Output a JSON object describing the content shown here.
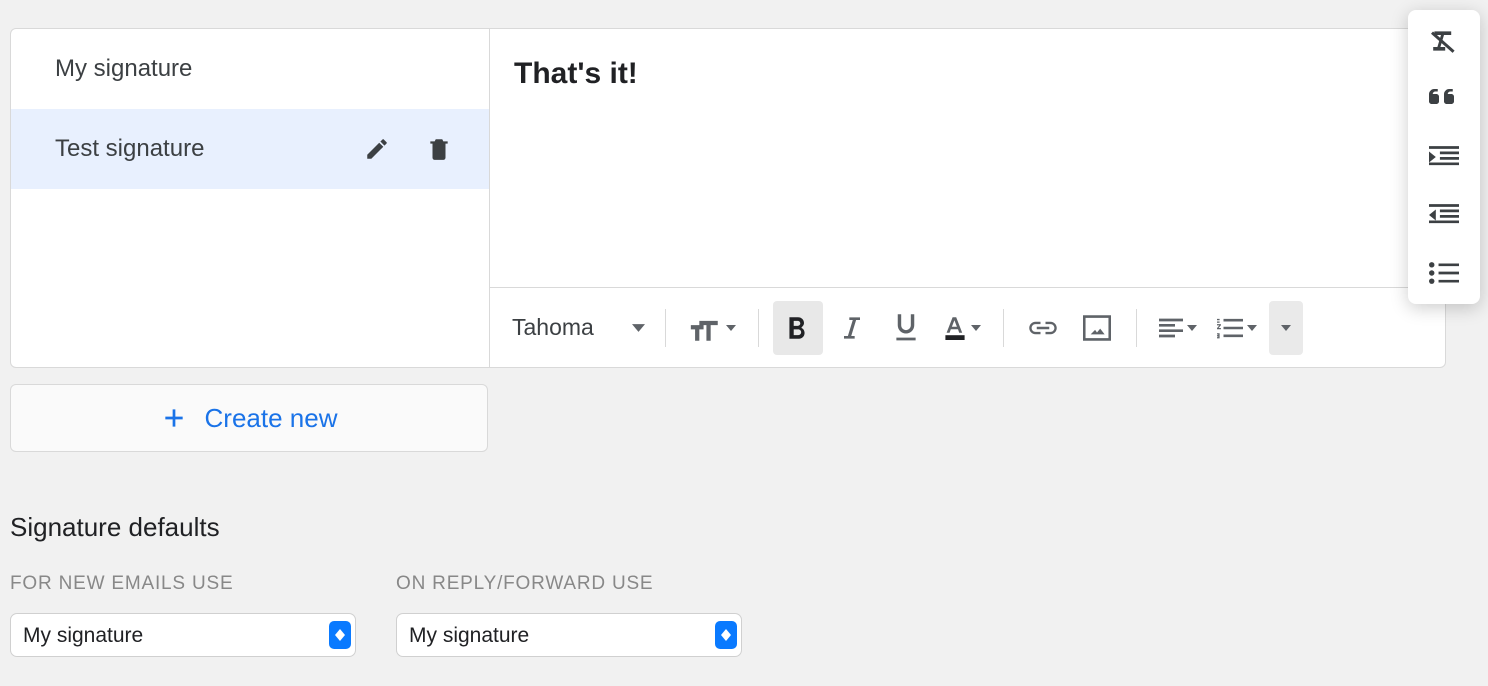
{
  "signatures": {
    "items": [
      {
        "name": "My signature",
        "selected": false
      },
      {
        "name": "Test signature",
        "selected": true
      }
    ]
  },
  "editor": {
    "content": "That's it!",
    "font_name": "Tahoma"
  },
  "create_new_label": "Create new",
  "defaults": {
    "title": "Signature defaults",
    "for_new": {
      "label": "FOR NEW EMAILS USE",
      "value": "My signature"
    },
    "on_reply": {
      "label": "ON REPLY/FORWARD USE",
      "value": "My signature"
    }
  }
}
